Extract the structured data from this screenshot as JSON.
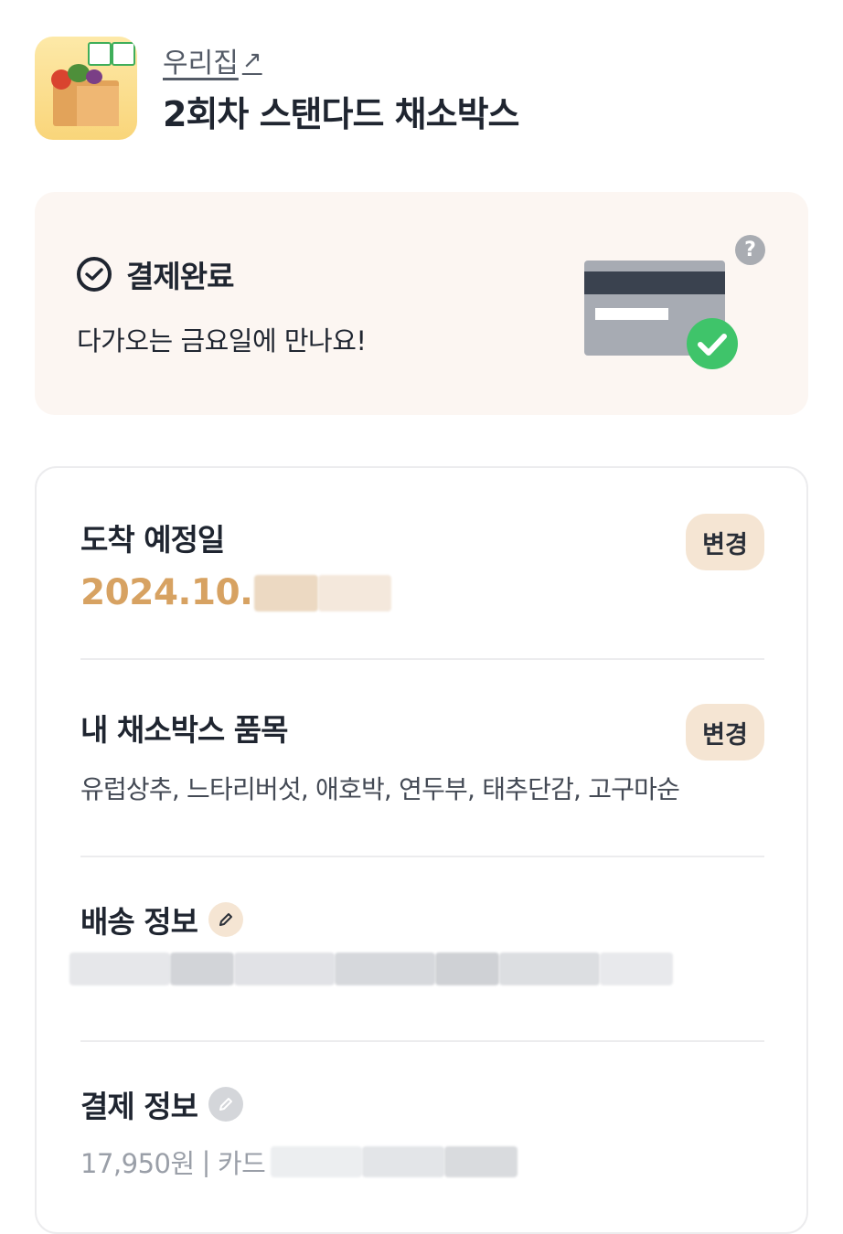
{
  "header": {
    "store_link": "우리집",
    "store_link_arrow": "↗",
    "product_title": "2회차 스탠다드 채소박스"
  },
  "status": {
    "title": "결제완료",
    "subtitle": "다가오는 금요일에 만나요!",
    "help_label": "?"
  },
  "arrival": {
    "title": "도착 예정일",
    "date_visible": "2024.10.",
    "change_label": "변경"
  },
  "box_items": {
    "title": "내 채소박스 품목",
    "items_text": "유럽상추, 느타리버섯, 애호박, 연두부, 태추단감, 고구마순",
    "change_label": "변경"
  },
  "shipping": {
    "title": "배송 정보"
  },
  "payment": {
    "title": "결제 정보",
    "amount": "17,950원",
    "separator": "|",
    "method": "카드"
  },
  "colors": {
    "accent_date": "#d7a262",
    "change_button_bg": "#f5e5d3",
    "status_card_bg": "#fcf6f2",
    "success_green": "#3fc46a"
  },
  "icons": {
    "status": "check-circle-icon",
    "help": "question-icon",
    "card": "credit-card-check-icon",
    "edit": "pencil-icon",
    "link": "external-arrow-icon"
  }
}
